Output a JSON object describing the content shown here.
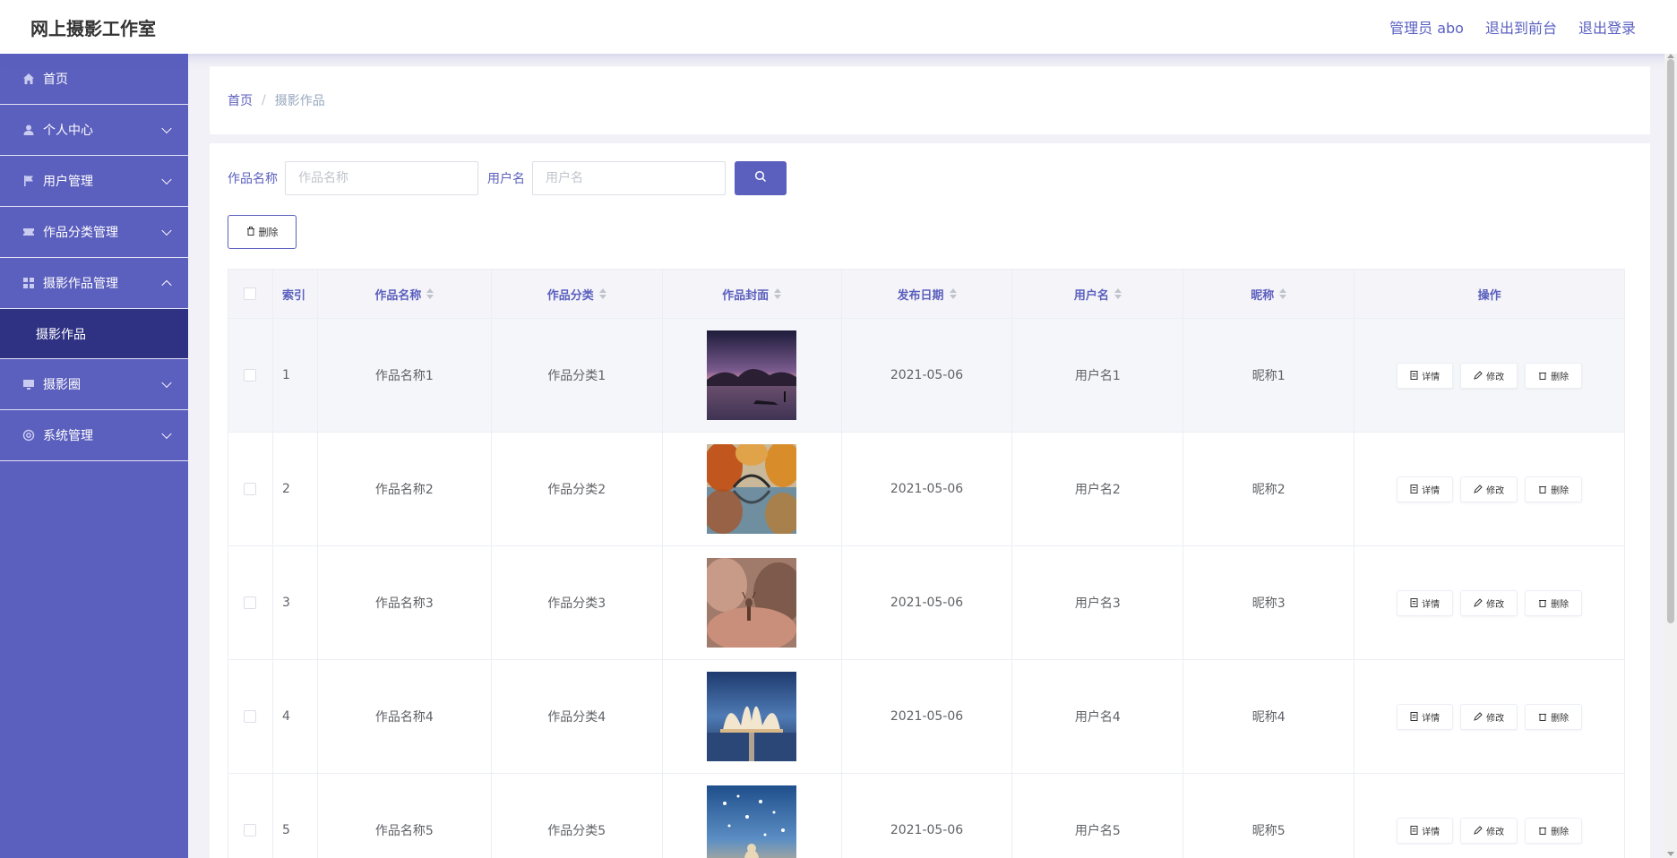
{
  "header": {
    "title": "网上摄影工作室",
    "admin": "管理员 abo",
    "to_front": "退出到前台",
    "logout": "退出登录"
  },
  "sidebar": {
    "items": [
      {
        "label": "首页",
        "icon": "home-icon",
        "expandable": false
      },
      {
        "label": "个人中心",
        "icon": "user-icon",
        "expandable": true
      },
      {
        "label": "用户管理",
        "icon": "flag-icon",
        "expandable": true
      },
      {
        "label": "作品分类管理",
        "icon": "ticket-icon",
        "expandable": true
      },
      {
        "label": "摄影作品管理",
        "icon": "grid-icon",
        "expandable": true,
        "expanded": true
      },
      {
        "label": "摄影圈",
        "icon": "monitor-icon",
        "expandable": true
      },
      {
        "label": "系统管理",
        "icon": "settings-icon",
        "expandable": true
      }
    ],
    "sub_active": "摄影作品"
  },
  "breadcrumb": {
    "home": "首页",
    "sep": "/",
    "current": "摄影作品"
  },
  "search": {
    "name_label": "作品名称",
    "name_placeholder": "作品名称",
    "user_label": "用户名",
    "user_placeholder": "用户名"
  },
  "toolbar": {
    "delete_label": "删除"
  },
  "table": {
    "headers": {
      "index": "索引",
      "name": "作品名称",
      "category": "作品分类",
      "cover": "作品封面",
      "date": "发布日期",
      "user": "用户名",
      "nick": "昵称",
      "ops": "操作"
    },
    "ops": {
      "detail": "详情",
      "edit": "修改",
      "delete": "删除"
    },
    "rows": [
      {
        "index": "1",
        "name": "作品名称1",
        "category": "作品分类1",
        "date": "2021-05-06",
        "user": "用户名1",
        "nick": "昵称1"
      },
      {
        "index": "2",
        "name": "作品名称2",
        "category": "作品分类2",
        "date": "2021-05-06",
        "user": "用户名2",
        "nick": "昵称2"
      },
      {
        "index": "3",
        "name": "作品名称3",
        "category": "作品分类3",
        "date": "2021-05-06",
        "user": "用户名3",
        "nick": "昵称3"
      },
      {
        "index": "4",
        "name": "作品名称4",
        "category": "作品分类4",
        "date": "2021-05-06",
        "user": "用户名4",
        "nick": "昵称4"
      },
      {
        "index": "5",
        "name": "作品名称5",
        "category": "作品分类5",
        "date": "2021-05-06",
        "user": "用户名5",
        "nick": "昵称5"
      }
    ]
  },
  "colors": {
    "accent": "#5b5fbd",
    "sidebar": "#5b5fbd",
    "sidebar_active": "#2f3282"
  }
}
